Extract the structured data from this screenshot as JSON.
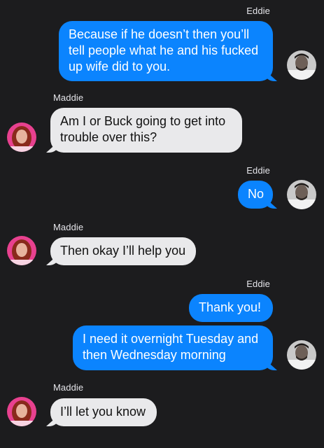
{
  "messages": [
    {
      "sender": "Eddie",
      "direction": "outgoing",
      "text": "Because if he doesn’t then you’ll tell people what he and his fucked up wife did to you."
    },
    {
      "sender": "Maddie",
      "direction": "incoming",
      "text": "Am I or Buck going to get into trouble over this?"
    },
    {
      "sender": "Eddie",
      "direction": "outgoing",
      "text": "No"
    },
    {
      "sender": "Maddie",
      "direction": "incoming",
      "text": "Then okay I’ll help you"
    },
    {
      "sender": "Eddie",
      "direction": "outgoing",
      "text": "Thank you!"
    },
    {
      "sender": "Eddie",
      "direction": "outgoing",
      "text": "I need it overnight Tuesday and then Wednesday morning"
    },
    {
      "sender": "Maddie",
      "direction": "incoming",
      "text": "I’ll let you know"
    }
  ],
  "colors": {
    "background": "#1c1c1e",
    "outgoing_bubble": "#0b84fe",
    "incoming_bubble": "#e9e9eb"
  },
  "icons": {
    "eddie_avatar": "man-portrait-avatar",
    "maddie_avatar": "woman-portrait-avatar"
  }
}
